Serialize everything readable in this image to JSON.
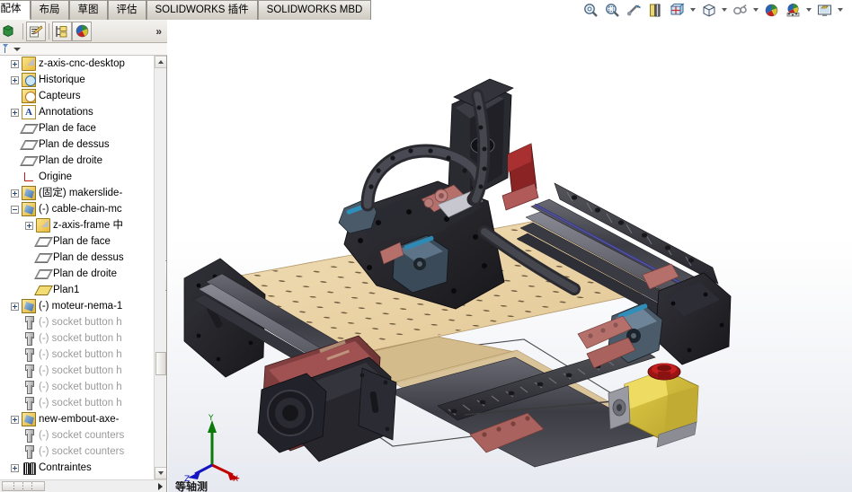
{
  "window": {
    "app": "SOLIDWORKS",
    "document_type": "assembly"
  },
  "tabs": [
    {
      "label": "装配体",
      "active": true,
      "name": "tab-assembly"
    },
    {
      "label": "布局",
      "active": false,
      "name": "tab-layout"
    },
    {
      "label": "草图",
      "active": false,
      "name": "tab-sketch"
    },
    {
      "label": "评估",
      "active": false,
      "name": "tab-evaluate"
    },
    {
      "label": "SOLIDWORKS 插件",
      "active": false,
      "name": "tab-solidworks-addins"
    },
    {
      "label": "SOLIDWORKS MBD",
      "active": false,
      "name": "tab-solidworks-mbd"
    }
  ],
  "command_bar": {
    "overflow_label": "»",
    "buttons": [
      {
        "name": "feature-manager-icon",
        "title": ""
      },
      {
        "name": "edit-appearance-icon",
        "title": ""
      },
      {
        "name": "display-state-icon",
        "title": ""
      },
      {
        "name": "appearances-sphere-icon",
        "title": ""
      }
    ]
  },
  "filter_bar": {
    "icon": "filter-flag-icon",
    "caret": "chevron-down-icon"
  },
  "view_toolbar": {
    "buttons": [
      {
        "name": "zoom-to-fit-icon",
        "caret": false
      },
      {
        "name": "zoom-to-area-icon",
        "caret": false
      },
      {
        "name": "previous-view-icon",
        "caret": false
      },
      {
        "name": "section-view-icon",
        "caret": false
      },
      {
        "name": "view-orientation-icon",
        "caret": true
      },
      {
        "name": "display-style-icon",
        "caret": true
      },
      {
        "name": "hide-show-items-icon",
        "caret": true
      },
      {
        "name": "edit-appearance-icon",
        "caret": false
      },
      {
        "name": "apply-scene-icon",
        "caret": true
      },
      {
        "name": "view-settings-icon",
        "caret": true
      }
    ]
  },
  "feature_tree": {
    "rows": [
      {
        "indent": 0,
        "expander": "plus",
        "icon": "assembly-icon",
        "label": "z-axis-cnc-desktop",
        "dim": false,
        "name": "tree-item-assembly-root"
      },
      {
        "indent": 0,
        "expander": "plus",
        "icon": "history-icon",
        "label": "Historique",
        "dim": false,
        "name": "tree-item-history"
      },
      {
        "indent": 0,
        "expander": "none",
        "icon": "sensors-icon",
        "label": "Capteurs",
        "dim": false,
        "name": "tree-item-sensors"
      },
      {
        "indent": 0,
        "expander": "plus",
        "icon": "annotations-icon",
        "label": "Annotations",
        "dim": false,
        "name": "tree-item-annotations"
      },
      {
        "indent": 0,
        "expander": "none",
        "icon": "plane-icon",
        "label": "Plan de face",
        "dim": false,
        "name": "tree-item-front-plane"
      },
      {
        "indent": 0,
        "expander": "none",
        "icon": "plane-icon",
        "label": "Plan de dessus",
        "dim": false,
        "name": "tree-item-top-plane"
      },
      {
        "indent": 0,
        "expander": "none",
        "icon": "plane-icon",
        "label": "Plan de droite",
        "dim": false,
        "name": "tree-item-right-plane"
      },
      {
        "indent": 0,
        "expander": "none",
        "icon": "origin-icon",
        "label": "Origine",
        "dim": false,
        "name": "tree-item-origin"
      },
      {
        "indent": 0,
        "expander": "plus",
        "icon": "component-icon",
        "label": "(固定) makerslide-",
        "dim": false,
        "name": "tree-item-makerslide"
      },
      {
        "indent": 0,
        "expander": "minus",
        "icon": "component-icon",
        "label": "(-) cable-chain-mc",
        "dim": false,
        "name": "tree-item-cable-chain"
      },
      {
        "indent": 1,
        "expander": "plus",
        "icon": "assembly-icon",
        "label": "z-axis-frame 中",
        "dim": false,
        "name": "tree-item-z-axis-frame"
      },
      {
        "indent": 1,
        "expander": "none",
        "icon": "plane-icon",
        "label": "Plan de face",
        "dim": false,
        "name": "tree-item-sub-front-plane"
      },
      {
        "indent": 1,
        "expander": "none",
        "icon": "plane-icon",
        "label": "Plan de dessus",
        "dim": false,
        "name": "tree-item-sub-top-plane"
      },
      {
        "indent": 1,
        "expander": "none",
        "icon": "plane-icon",
        "label": "Plan de droite",
        "dim": false,
        "name": "tree-item-sub-right-plane"
      },
      {
        "indent": 1,
        "expander": "none",
        "icon": "plane1-icon",
        "label": "Plan1",
        "dim": false,
        "name": "tree-item-plane1"
      },
      {
        "indent": 0,
        "expander": "plus",
        "icon": "component-icon",
        "label": "(-) moteur-nema-1",
        "dim": false,
        "name": "tree-item-moteur-nema"
      },
      {
        "indent": 0,
        "expander": "none",
        "icon": "bolt-icon",
        "label": "(-) socket button h",
        "dim": true,
        "name": "tree-item-socket-button-1"
      },
      {
        "indent": 0,
        "expander": "none",
        "icon": "bolt-icon",
        "label": "(-) socket button h",
        "dim": true,
        "name": "tree-item-socket-button-2"
      },
      {
        "indent": 0,
        "expander": "none",
        "icon": "bolt-icon",
        "label": "(-) socket button h",
        "dim": true,
        "name": "tree-item-socket-button-3"
      },
      {
        "indent": 0,
        "expander": "none",
        "icon": "bolt-icon",
        "label": "(-) socket button h",
        "dim": true,
        "name": "tree-item-socket-button-4"
      },
      {
        "indent": 0,
        "expander": "none",
        "icon": "bolt-icon",
        "label": "(-) socket button h",
        "dim": true,
        "name": "tree-item-socket-button-5"
      },
      {
        "indent": 0,
        "expander": "none",
        "icon": "bolt-icon",
        "label": "(-) socket button h",
        "dim": true,
        "name": "tree-item-socket-button-6"
      },
      {
        "indent": 0,
        "expander": "plus",
        "icon": "component-icon",
        "label": "new-embout-axe-",
        "dim": false,
        "name": "tree-item-new-embout-axe"
      },
      {
        "indent": 0,
        "expander": "none",
        "icon": "bolt-icon",
        "label": "(-) socket counters",
        "dim": true,
        "name": "tree-item-socket-countersunk-1"
      },
      {
        "indent": 0,
        "expander": "none",
        "icon": "bolt-icon",
        "label": "(-) socket counters",
        "dim": true,
        "name": "tree-item-socket-countersunk-2"
      },
      {
        "indent": 0,
        "expander": "plus",
        "icon": "mates-icon",
        "label": "Contraintes",
        "dim": false,
        "name": "tree-item-mates"
      }
    ]
  },
  "scrollbars": {
    "horizontal_thumb_label": "⋮⋮⋮"
  },
  "viewport": {
    "status_text": "等轴测",
    "triad": {
      "x_label": "X",
      "y_label": "Y",
      "z_label": "Z",
      "x_color": "#cc0000",
      "y_color": "#008000",
      "z_color": "#0000cc"
    },
    "model": {
      "name": "z-axis-cnc-desktop",
      "description": "Desktop CNC router assembly, isometric view",
      "parts": [
        {
          "name": "spoilboard",
          "color": "#ecd8ae"
        },
        {
          "name": "aluminium-extrusion-rail",
          "color": "#4a4a52"
        },
        {
          "name": "gantry-plate",
          "color": "#2a2a2d"
        },
        {
          "name": "cable-chain",
          "color": "#3a3a3d"
        },
        {
          "name": "stepper-motor",
          "color": "#7a3b3b"
        },
        {
          "name": "spindle-router",
          "color": "#8f2f2f"
        },
        {
          "name": "emergency-stop-button",
          "color": "#d9c13a"
        },
        {
          "name": "emergency-stop-cap",
          "color": "#a51717"
        },
        {
          "name": "selected-edge-highlight",
          "color": "#ff00ff"
        },
        {
          "name": "lead-screw",
          "color": "#3b3b6e"
        }
      ]
    }
  },
  "colors": {
    "tab_active_bg": "#ffffff",
    "tab_inactive_bg": "#ddd9d2",
    "chrome_bg": "#d6d3ce",
    "viewport_top": "#ffffff",
    "viewport_bottom": "#e6e9f0",
    "tree_dim_text": "#9b9b9b",
    "highlight_magenta": "#ff00ff"
  }
}
